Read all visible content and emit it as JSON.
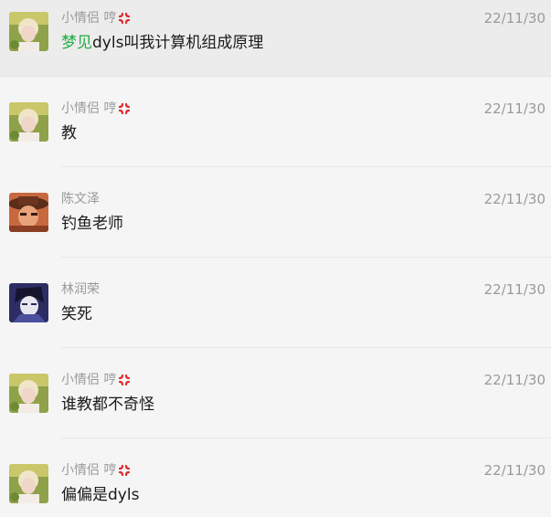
{
  "messages": [
    {
      "sender": "小情侣 哼",
      "sender_icon": "anger-symbol-icon",
      "time": "22/11/30",
      "mention": "梦见",
      "text": "dyls叫我计算机组成原理",
      "avatar": "blonde-girl-photo"
    },
    {
      "sender": "小情侣 哼",
      "sender_icon": "anger-symbol-icon",
      "time": "22/11/30",
      "text": "教",
      "avatar": "blonde-girl-photo"
    },
    {
      "sender": "陈文泽",
      "time": "22/11/30",
      "text": "钓鱼老师",
      "avatar": "anime-hat-character"
    },
    {
      "sender": "林润荣",
      "time": "22/11/30",
      "text": "笑死",
      "avatar": "dark-anime-boy"
    },
    {
      "sender": "小情侣 哼",
      "sender_icon": "anger-symbol-icon",
      "time": "22/11/30",
      "text": "谁教都不奇怪",
      "avatar": "blonde-girl-photo"
    },
    {
      "sender": "小情侣 哼",
      "sender_icon": "anger-symbol-icon",
      "time": "22/11/30",
      "text": "偏偏是dyls",
      "avatar": "blonde-girl-photo"
    }
  ],
  "colors": {
    "mention": "#1fae45",
    "sender": "#9a9a9a",
    "text": "#1a1a1a",
    "background": "#f5f5f5",
    "highlight_row": "#ececec"
  }
}
